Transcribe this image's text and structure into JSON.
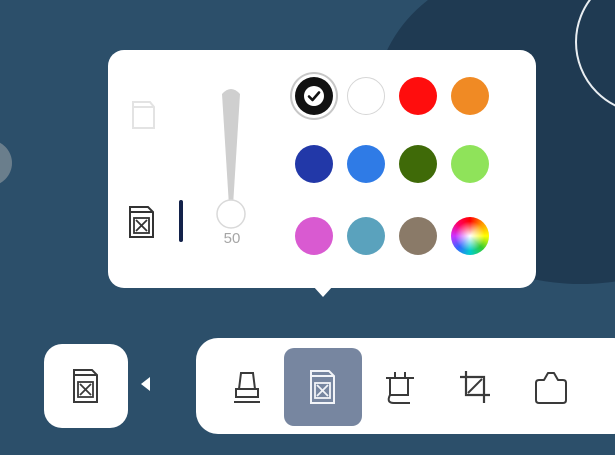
{
  "pen_popup": {
    "modes": [
      {
        "name": "fill",
        "icon": "fill-mode-icon",
        "selected": false
      },
      {
        "name": "eraser",
        "icon": "eraser-mode-icon",
        "selected": true
      }
    ],
    "size": {
      "value": "50",
      "level": 0.0
    },
    "swatches": [
      {
        "color": "#111111",
        "selected": true
      },
      {
        "color": "#ffffff",
        "selected": false
      },
      {
        "color": "#ff0d0d",
        "selected": false
      },
      {
        "color": "#f08a24",
        "selected": false
      },
      {
        "color": "#2238a8",
        "selected": false
      },
      {
        "color": "#2f7be6",
        "selected": false
      },
      {
        "color": "#3f6a08",
        "selected": false
      },
      {
        "color": "#8fe35a",
        "selected": false
      },
      {
        "color": "#d95ad1",
        "selected": false
      },
      {
        "color": "#5aa2bd",
        "selected": false
      },
      {
        "color": "#8a7a68",
        "selected": false
      },
      {
        "color": "rainbow",
        "selected": false
      }
    ]
  },
  "toolbar": {
    "tools": [
      {
        "icon": "highlighter-icon",
        "active": false
      },
      {
        "icon": "eraser-icon",
        "active": true
      },
      {
        "icon": "lasso-icon",
        "active": false
      },
      {
        "icon": "crop-icon",
        "active": false
      },
      {
        "icon": "shape-icon",
        "active": false
      }
    ],
    "accent": "#7786a0"
  }
}
